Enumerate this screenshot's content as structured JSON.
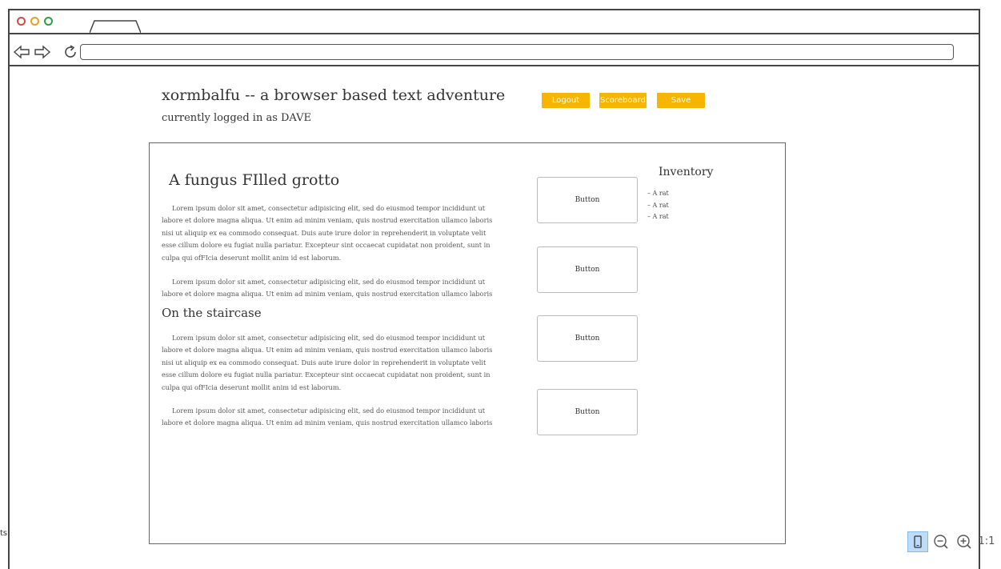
{
  "page": {
    "title": "xormbalfu -- a browser based text adventure",
    "subtitle": "currently logged in as DAVE"
  },
  "header_buttons": {
    "logout": "Logout",
    "scoreboard": "Scoreboard",
    "save": "Save"
  },
  "rooms": [
    {
      "title": "A fungus FIlled grotto",
      "paragraphs": [
        "Lorem ipsum dolor sit amet, consectetur adipisicing elit, sed do eiusmod tempor incididunt ut labore et dolore magna aliqua. Ut enim ad minim veniam, quis nostrud exercitation ullamco laboris nisi ut aliquip ex ea commodo consequat. Duis aute irure dolor in reprehenderit in voluptate velit esse cillum dolore eu fugiat nulla pariatur. Excepteur sint occaecat cupidatat non proident, sunt in culpa qui ofFIcia deserunt mollit anim id est laborum.",
        "Lorem ipsum dolor sit amet, consectetur adipisicing elit, sed do eiusmod tempor incididunt ut labore et dolore magna aliqua. Ut enim ad minim veniam, quis nostrud exercitation ullamco laboris nisi ut aliquip ex"
      ]
    },
    {
      "title": "On the staircase",
      "paragraphs": [
        "Lorem ipsum dolor sit amet, consectetur adipisicing elit, sed do eiusmod tempor incididunt ut labore et dolore magna aliqua. Ut enim ad minim veniam, quis nostrud exercitation ullamco laboris nisi ut aliquip ex ea commodo consequat. Duis aute irure dolor in reprehenderit in voluptate velit esse cillum dolore eu fugiat nulla pariatur. Excepteur sint occaecat cupidatat non proident, sunt in culpa qui ofFIcia deserunt mollit anim id est laborum.",
        "Lorem ipsum dolor sit amet, consectetur adipisicing elit, sed do eiusmod tempor incididunt ut labore et dolore magna aliqua. Ut enim ad minim veniam, quis nostrud exercitation ullamco laboris nisi ut aliquip ex"
      ]
    }
  ],
  "actions": [
    "Button",
    "Button",
    "Button",
    "Button"
  ],
  "inventory": {
    "title": "Inventory",
    "items": [
      "A rat",
      "A rat",
      "A rat"
    ]
  },
  "editor": {
    "side_text": "ts",
    "zoom_reset_label": "1:1"
  },
  "colors": {
    "accent_button": "#f7b500",
    "zoom_fit_active": "#bcdcfa"
  },
  "icons": {
    "back": "arrow-left-icon",
    "forward": "arrow-right-icon",
    "reload": "reload-icon",
    "zoom_fit": "mobile-device-icon",
    "zoom_out": "zoom-out-icon",
    "zoom_in": "zoom-in-icon"
  }
}
